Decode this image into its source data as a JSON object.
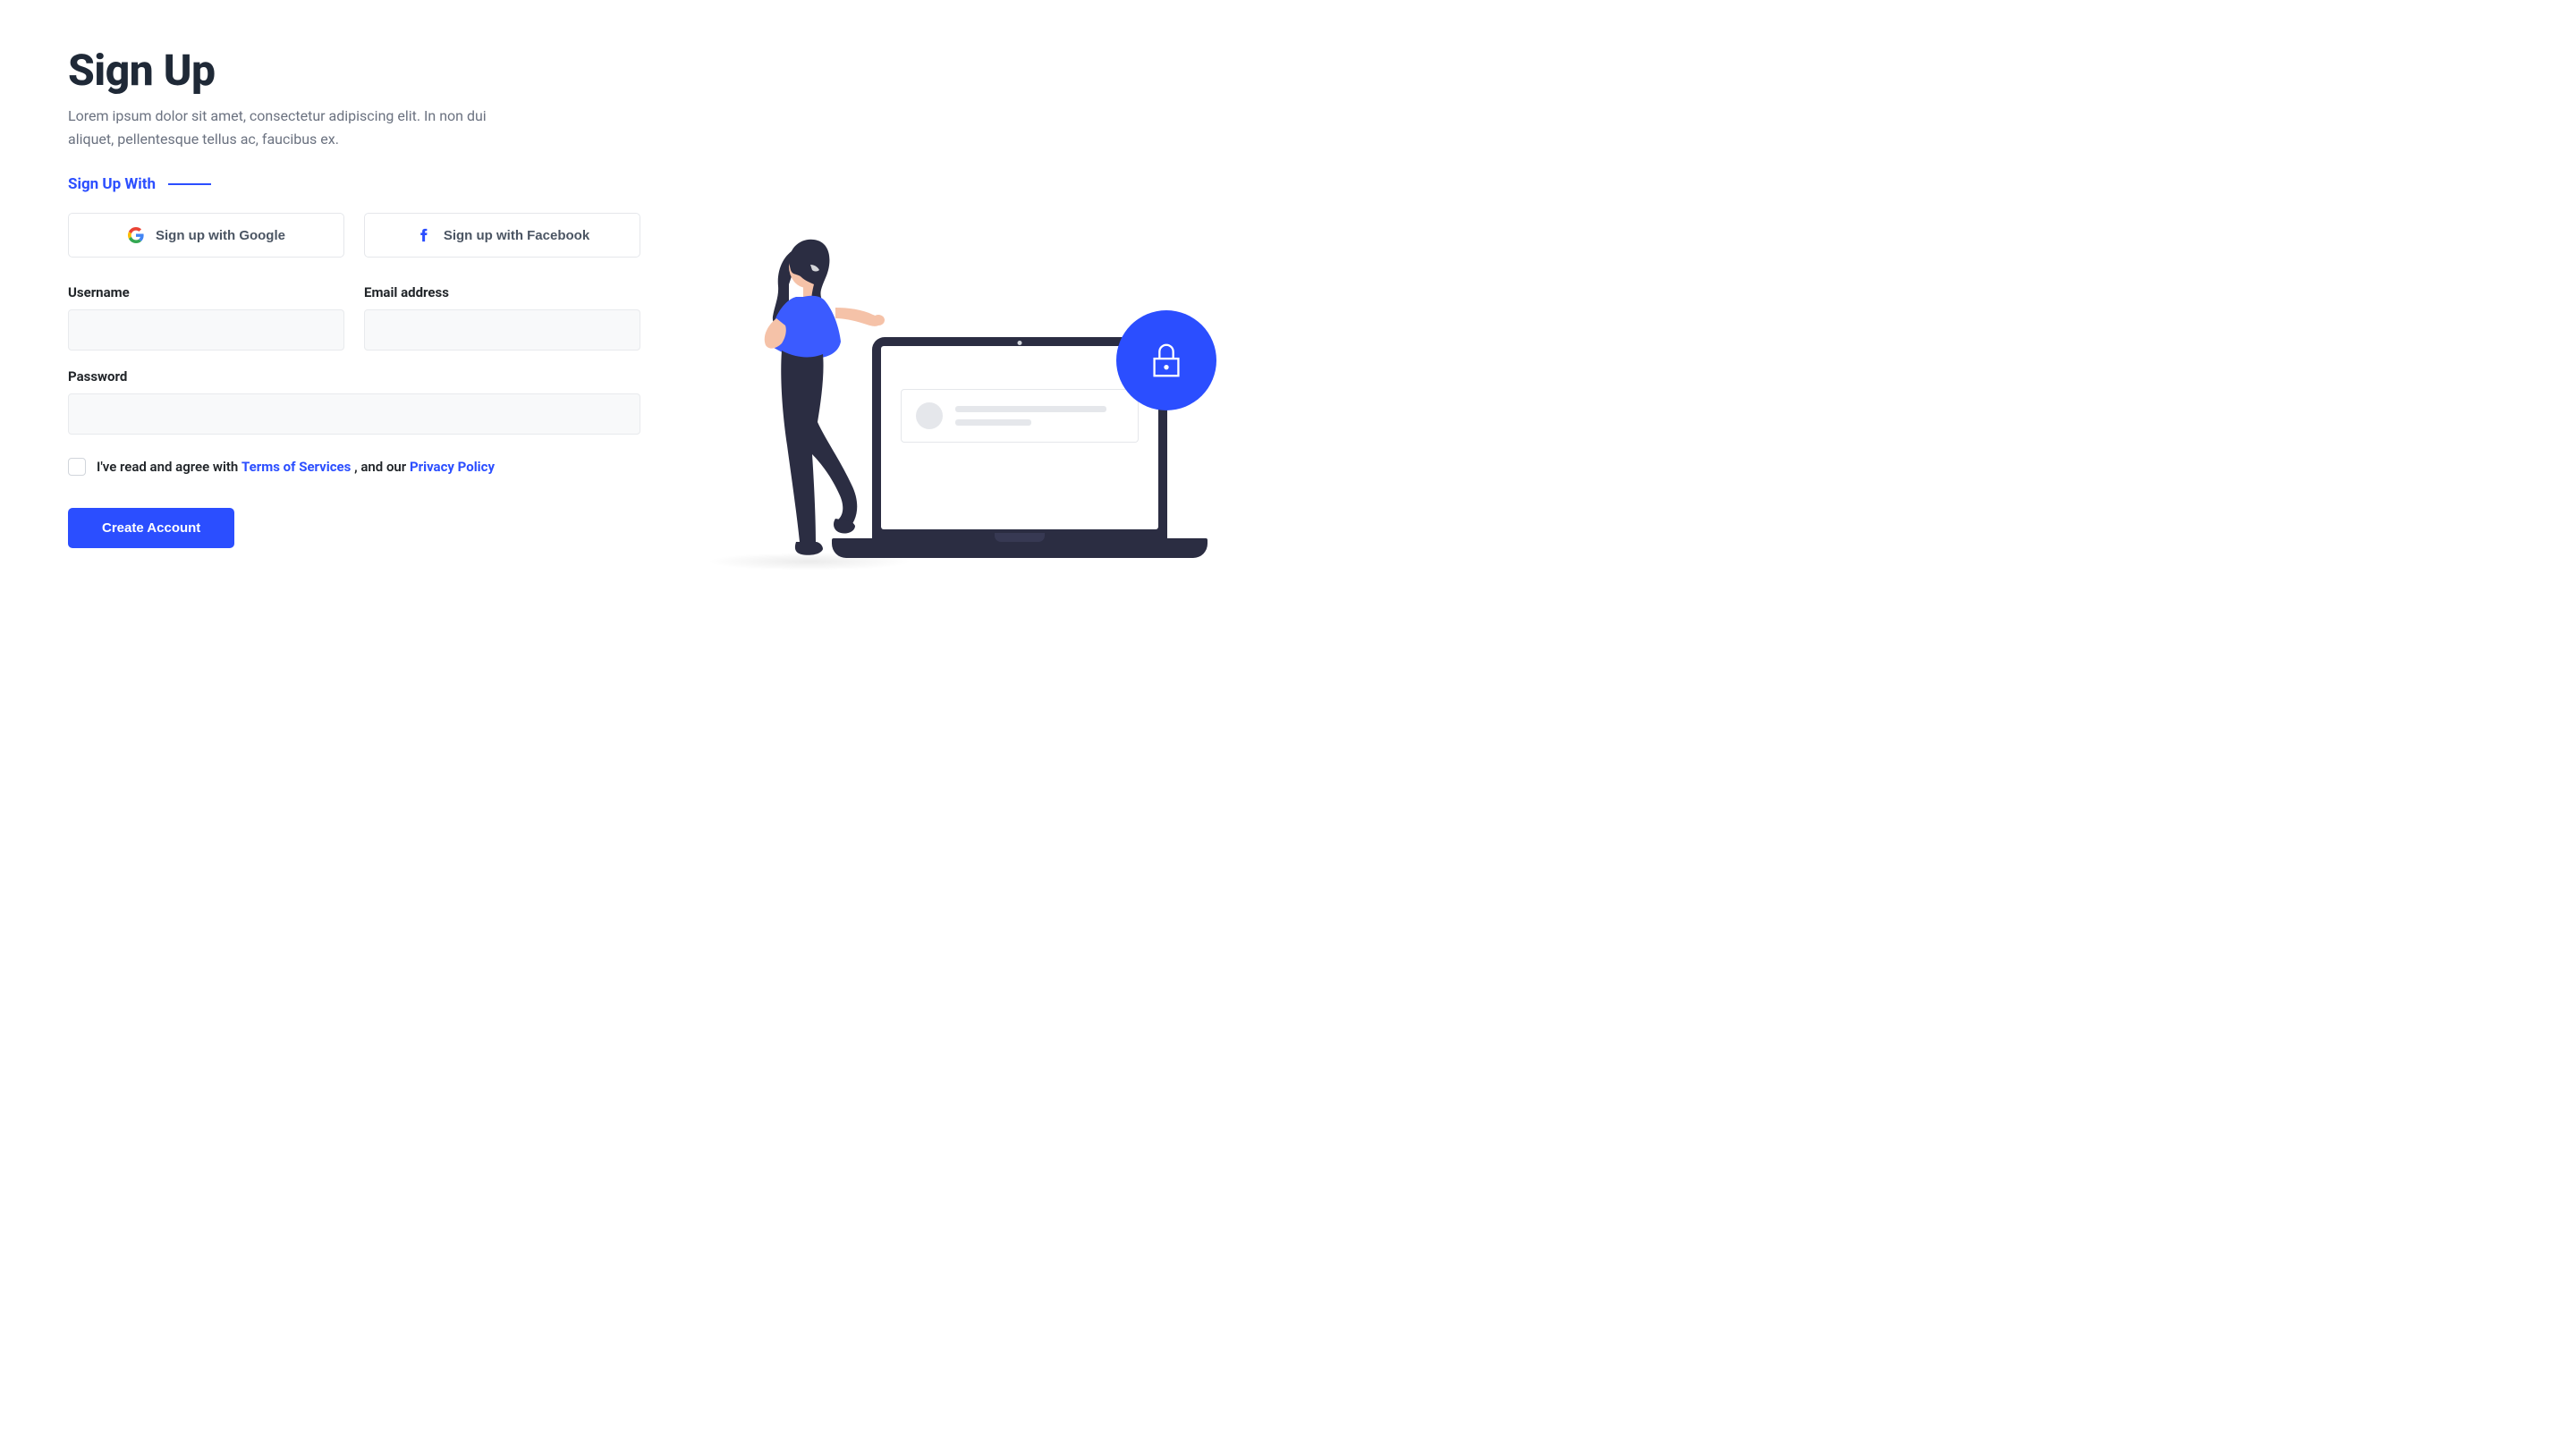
{
  "header": {
    "title": "Sign Up",
    "subtitle": "Lorem ipsum dolor sit amet, consectetur adipiscing elit. In non dui aliquet, pellentesque tellus ac, faucibus ex."
  },
  "social": {
    "heading": "Sign Up With",
    "google_label": "Sign up with Google",
    "facebook_label": "Sign up with Facebook"
  },
  "form": {
    "username_label": "Username",
    "email_label": "Email address",
    "password_label": "Password",
    "username_value": "",
    "email_value": "",
    "password_value": ""
  },
  "terms": {
    "prefix": "I've read and agree with ",
    "tos": "Terms of Services",
    "middle": " , and our ",
    "privacy": "Privacy Policy"
  },
  "submit": {
    "label": "Create Account"
  },
  "colors": {
    "primary": "#2b4eff",
    "text_dark": "#1f2937",
    "text_muted": "#6b7280",
    "border": "#e5e7eb",
    "input_bg": "#f8f9fa"
  }
}
